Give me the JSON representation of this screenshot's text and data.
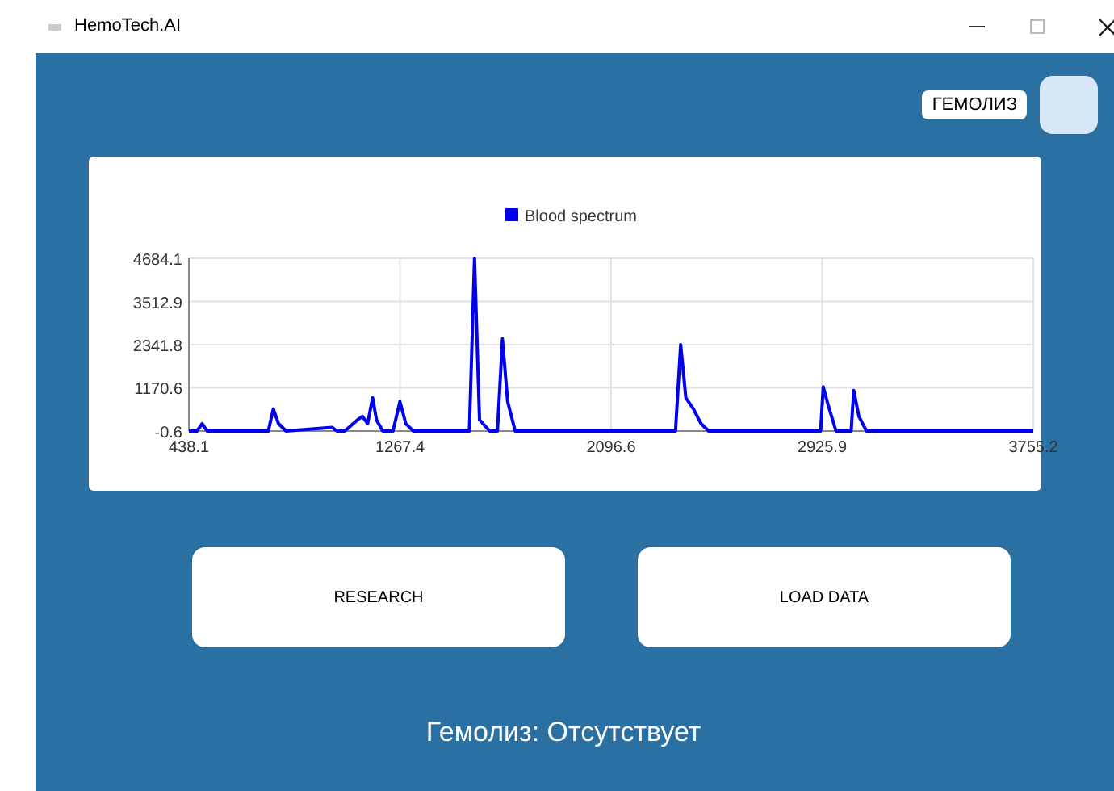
{
  "window": {
    "title": "HemoTech.AI"
  },
  "badge": {
    "label": "ГЕМОЛИЗ"
  },
  "chart_data": {
    "type": "line",
    "grid": true,
    "x": [
      438.1,
      470,
      490,
      510,
      700,
      750,
      770,
      790,
      820,
      1000,
      1020,
      1050,
      1100,
      1120,
      1140,
      1160,
      1175,
      1200,
      1240,
      1267,
      1290,
      1320,
      1500,
      1540,
      1560,
      1580,
      1620,
      1650,
      1670,
      1690,
      1720,
      2300,
      2350,
      2370,
      2390,
      2420,
      2450,
      2480,
      2900,
      2920,
      2930,
      2950,
      2980,
      3020,
      3040,
      3050,
      3070,
      3100,
      3755.2
    ],
    "series": [
      {
        "name": "Blood spectrum",
        "color": "#0000ee",
        "values": [
          0,
          0,
          200,
          0,
          0,
          0,
          600,
          200,
          0,
          100,
          0,
          0,
          300,
          400,
          200,
          900,
          300,
          0,
          0,
          800,
          200,
          0,
          0,
          0,
          4680,
          300,
          0,
          0,
          2500,
          800,
          0,
          0,
          0,
          2340,
          900,
          600,
          200,
          0,
          0,
          0,
          1200,
          700,
          0,
          0,
          0,
          1100,
          400,
          0,
          0
        ]
      }
    ],
    "xlim": [
      438.1,
      3755.2
    ],
    "ylim": [
      -0.6,
      4684.1
    ],
    "xticks": [
      438.1,
      1267.4,
      2096.6,
      2925.9,
      3755.2
    ],
    "yticks": [
      -0.6,
      1170.6,
      2341.8,
      3512.9,
      4684.1
    ]
  },
  "buttons": [
    "RESEARCH",
    "LOAD DATA"
  ],
  "status": "Гемолиз: Отсутствует"
}
